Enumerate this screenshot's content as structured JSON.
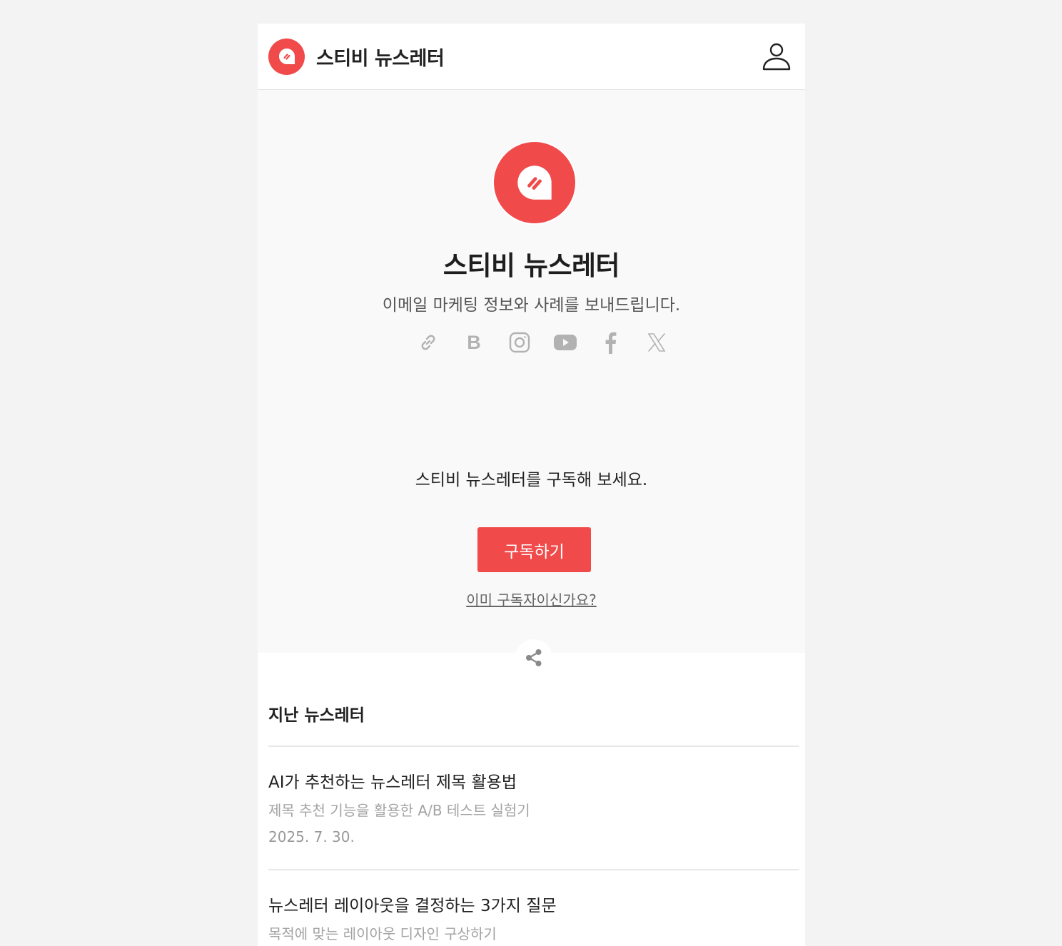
{
  "header": {
    "title": "스티비 뉴스레터"
  },
  "hero": {
    "title": "스티비 뉴스레터",
    "description": "이메일 마케팅 정보와 사례를 보내드립니다.",
    "social_icons": [
      "link-icon",
      "blog-icon",
      "instagram-icon",
      "youtube-icon",
      "facebook-icon",
      "x-icon"
    ],
    "blog_letter": "B",
    "subscribe_prompt": "스티비 뉴스레터를 구독해 보세요.",
    "subscribe_button": "구독하기",
    "already_subscribed_link": "이미 구독자이신가요?"
  },
  "past": {
    "heading": "지난 뉴스레터",
    "items": [
      {
        "title": "AI가 추천하는 뉴스레터 제목 활용법",
        "subtitle": "제목 추천 기능을 활용한 A/B 테스트 실험기",
        "date": "2025. 7. 30."
      },
      {
        "title": "뉴스레터 레이아웃을 결정하는 3가지 질문",
        "subtitle": "목적에 맞는 레이아웃 디자인 구상하기"
      }
    ]
  },
  "colors": {
    "brand": "#f04a4a",
    "page_background": "#f3f3f3",
    "hero_background": "#f9f9f9"
  }
}
